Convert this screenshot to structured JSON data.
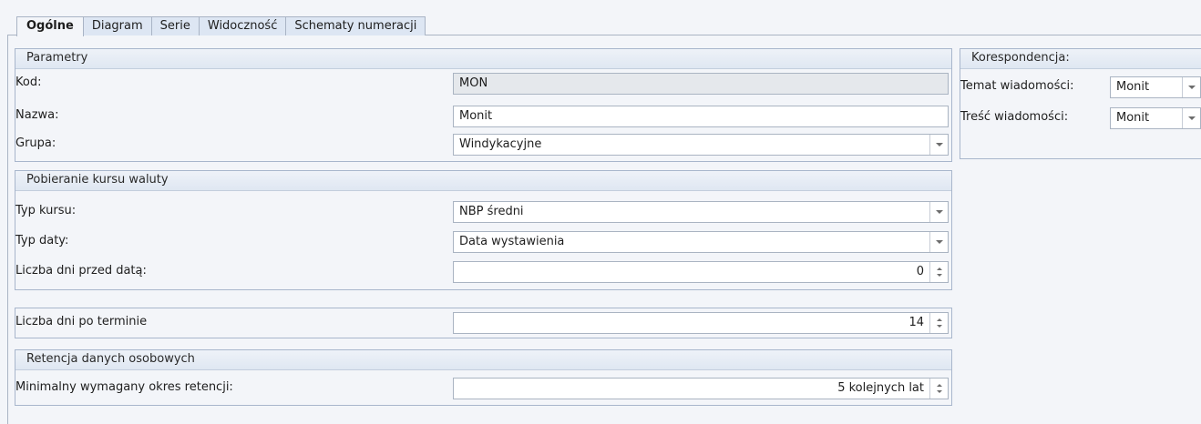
{
  "tabs": [
    {
      "label": "Ogólne",
      "active": true
    },
    {
      "label": "Diagram",
      "active": false
    },
    {
      "label": "Serie",
      "active": false
    },
    {
      "label": "Widoczność",
      "active": false
    },
    {
      "label": "Schematy numeracji",
      "active": false
    }
  ],
  "parametry": {
    "header": "Parametry",
    "kod_label": "Kod:",
    "kod_value": "MON",
    "nazwa_label": "Nazwa:",
    "nazwa_value": "Monit",
    "grupa_label": "Grupa:",
    "grupa_value": "Windykacyjne"
  },
  "kurs": {
    "header": "Pobieranie kursu waluty",
    "typ_kursu_label": "Typ kursu:",
    "typ_kursu_value": "NBP średni",
    "typ_daty_label": "Typ daty:",
    "typ_daty_value": "Data wystawienia",
    "dni_przed_label": "Liczba dni przed datą:",
    "dni_przed_value": "0"
  },
  "termin": {
    "label": "Liczba dni po terminie",
    "value": "14"
  },
  "retencja": {
    "header": "Retencja danych osobowych",
    "label": "Minimalny wymagany okres retencji:",
    "value": "5 kolejnych lat"
  },
  "korespondencja": {
    "header": "Korespondencja:",
    "temat_label": "Temat wiadomości:",
    "temat_value": "Monit",
    "tresc_label": "Treść wiadomości:",
    "tresc_value": "Monit"
  }
}
